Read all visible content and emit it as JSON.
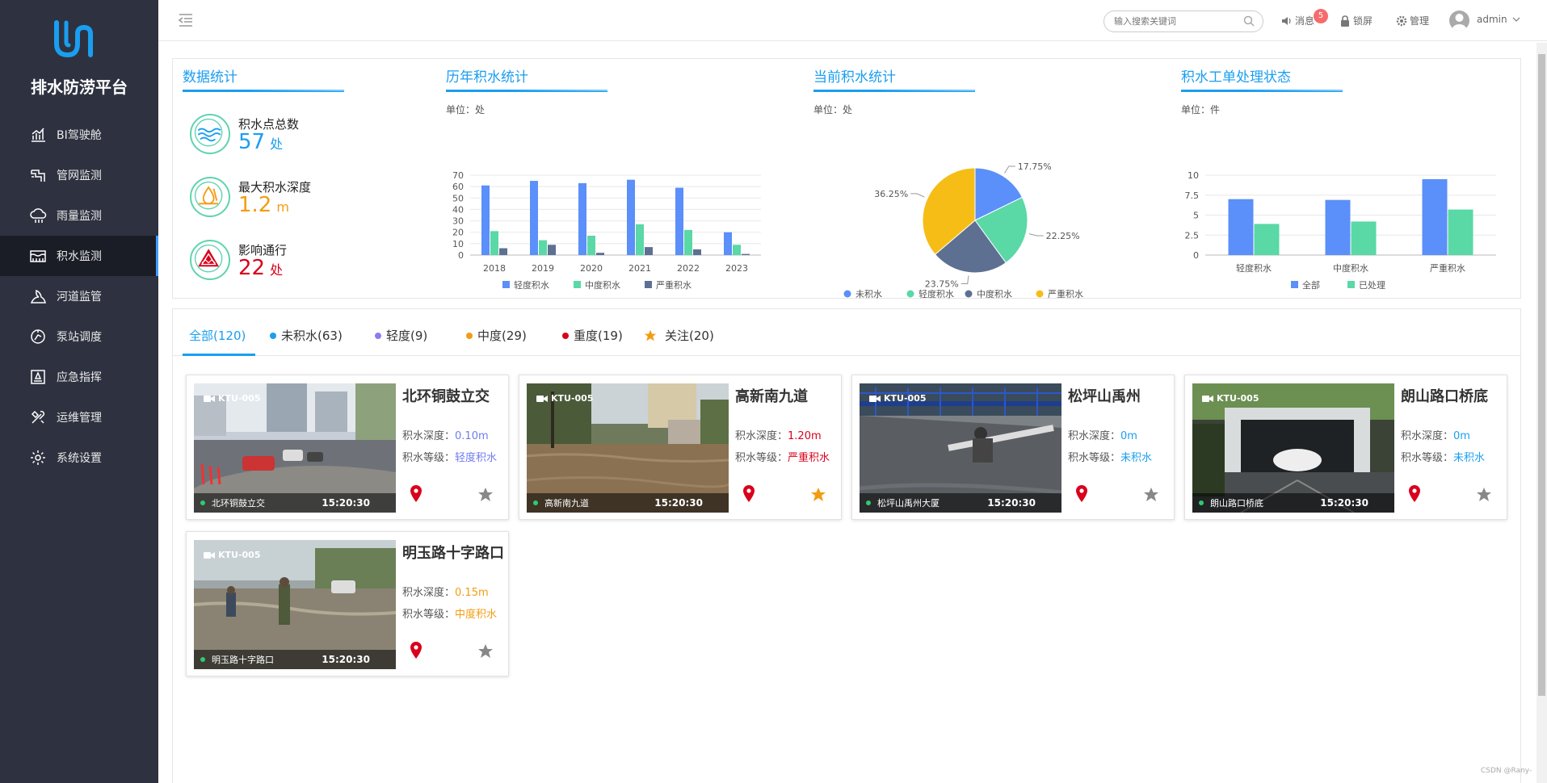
{
  "app": {
    "title": "排水防涝平台"
  },
  "nav": [
    {
      "label": "BI驾驶舱",
      "icon": "chart-icon"
    },
    {
      "label": "管网监测",
      "icon": "pipe-icon"
    },
    {
      "label": "雨量监测",
      "icon": "rain-cloud-icon"
    },
    {
      "label": "积水监测",
      "icon": "water-level-icon",
      "active": true
    },
    {
      "label": "河道监管",
      "icon": "river-icon"
    },
    {
      "label": "泵站调度",
      "icon": "pump-icon"
    },
    {
      "label": "应急指挥",
      "icon": "emergency-icon"
    },
    {
      "label": "运维管理",
      "icon": "tools-icon"
    },
    {
      "label": "系统设置",
      "icon": "gear-icon"
    }
  ],
  "topbar": {
    "search_placeholder": "输入搜索关键词",
    "messages": "消息",
    "message_count": "5",
    "lock": "锁屏",
    "manage": "管理",
    "user": "admin"
  },
  "stats": {
    "title": "数据统计",
    "items": [
      {
        "label": "积水点总数",
        "value": "57",
        "unit": "处",
        "color": "#1a9ef0"
      },
      {
        "label": "最大积水深度",
        "value": "1.2",
        "unit": "m",
        "color": "#f39c12"
      },
      {
        "label": "影响通行",
        "value": "22",
        "unit": "处",
        "color": "#d9001b"
      }
    ]
  },
  "chart_data": [
    {
      "type": "bar",
      "title": "历年积水统计",
      "unit": "单位：处",
      "categories": [
        "2018",
        "2019",
        "2020",
        "2021",
        "2022",
        "2023"
      ],
      "series": [
        {
          "name": "轻度积水",
          "color": "#5b8ff9",
          "values": [
            61,
            65,
            63,
            66,
            59,
            20
          ]
        },
        {
          "name": "中度积水",
          "color": "#5ad8a6",
          "values": [
            21,
            13,
            17,
            27,
            22,
            9
          ]
        },
        {
          "name": "严重积水",
          "color": "#5d7092",
          "values": [
            6,
            9,
            2,
            7,
            5,
            1
          ]
        }
      ],
      "ylim": [
        0,
        70
      ],
      "yticks": [
        "0",
        "10",
        "20",
        "30",
        "40",
        "50",
        "60",
        "70"
      ],
      "grid": true,
      "legend": "bottom"
    },
    {
      "type": "pie",
      "title": "当前积水统计",
      "unit": "单位：处",
      "slices": [
        {
          "name": "未积水",
          "value": 17.75,
          "label": "17.75%",
          "color": "#5b8ff9"
        },
        {
          "name": "轻度积水",
          "value": 22.25,
          "label": "22.25%",
          "color": "#5ad8a6"
        },
        {
          "name": "中度积水",
          "value": 23.75,
          "label": "23.75%",
          "color": "#5d7092"
        },
        {
          "name": "严重积水",
          "value": 36.25,
          "label": "36.25%",
          "color": "#f6bd16"
        }
      ],
      "legend": "bottom"
    },
    {
      "type": "bar",
      "title": "积水工单处理状态",
      "unit": "单位：件",
      "categories": [
        "轻度积水",
        "中度积水",
        "严重积水"
      ],
      "series": [
        {
          "name": "全部",
          "color": "#5b8ff9",
          "values": [
            7,
            6.9,
            9.5
          ]
        },
        {
          "name": "已处理",
          "color": "#5ad8a6",
          "values": [
            3.9,
            4.2,
            5.7
          ]
        }
      ],
      "ylim": [
        0,
        10
      ],
      "yticks": [
        "0",
        "2.5",
        "5",
        "7.5",
        "10"
      ],
      "grid": true,
      "legend": "bottom"
    }
  ],
  "tabs": [
    {
      "label": "全部(120)",
      "active": true
    },
    {
      "label": "未积水(63)",
      "dot": "#1a9ef0"
    },
    {
      "label": "轻度(9)",
      "dot": "#8c7cf0"
    },
    {
      "label": "中度(29)",
      "dot": "#f39c12"
    },
    {
      "label": "重度(19)",
      "dot": "#d9001b"
    },
    {
      "label": "关注(20)",
      "star": "#f39c12"
    }
  ],
  "cards": [
    {
      "name": "北环铜鼓立交",
      "caption": "北环铜鼓立交",
      "camera": "KTU-005",
      "time": "15:20:30",
      "depth_label": "积水深度：",
      "depth": "0.10m",
      "depth_color": "#6f7cf0",
      "level_label": "积水等级：",
      "level": "轻度积水",
      "level_color": "#6f7cf0",
      "starred": false,
      "scene": "road"
    },
    {
      "name": "高新南九道",
      "caption": "高新南九道",
      "camera": "KTU-005",
      "time": "15:20:30",
      "depth_label": "积水深度：",
      "depth": "1.20m",
      "depth_color": "#d9001b",
      "level_label": "积水等级：",
      "level": "严重积水",
      "level_color": "#d9001b",
      "starred": true,
      "scene": "flood"
    },
    {
      "name": "松坪山禹州",
      "caption": "松坪山禹州大厦",
      "camera": "KTU-005",
      "time": "15:20:30",
      "depth_label": "积水深度：",
      "depth": "0m",
      "depth_color": "#1a9ef0",
      "level_label": "积水等级：",
      "level": "未积水",
      "level_color": "#1a9ef0",
      "starred": false,
      "scene": "worker"
    },
    {
      "name": "朗山路口桥底",
      "caption": "朗山路口桥底",
      "camera": "KTU-005",
      "time": "15:20:30",
      "depth_label": "积水深度：",
      "depth": "0m",
      "depth_color": "#1a9ef0",
      "level_label": "积水等级：",
      "level": "未积水",
      "level_color": "#1a9ef0",
      "starred": false,
      "scene": "tunnel"
    },
    {
      "name": "明玉路十字路口",
      "caption": "明玉路十字路口",
      "camera": "KTU-005",
      "time": "15:20:30",
      "depth_label": "积水深度：",
      "depth": "0.15m",
      "depth_color": "#f39c12",
      "level_label": "积水等级：",
      "level": "中度积水",
      "level_color": "#f39c12",
      "starred": false,
      "scene": "people"
    }
  ],
  "watermark": "CSDN @Rany-"
}
